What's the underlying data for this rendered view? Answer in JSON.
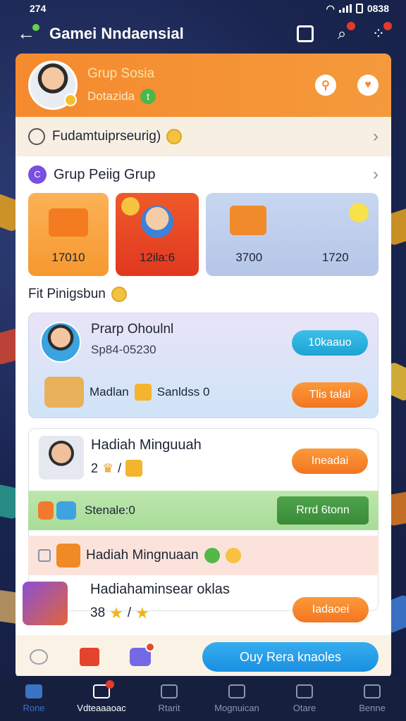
{
  "status": {
    "time": "274",
    "clock": "0838"
  },
  "appbar": {
    "title": "Gamei Nndaensial"
  },
  "profile": {
    "name": "Grup Sosia",
    "sub": "Dotazida",
    "sub_icon": "t"
  },
  "row1": {
    "label": "Fudamtuiprseurig)"
  },
  "group": {
    "label": "Grup Peiig Grup",
    "icon": "C"
  },
  "tiles": [
    {
      "value": "17010"
    },
    {
      "value": "12ila:6"
    },
    {
      "value_a": "3700",
      "value_b": "1720"
    }
  ],
  "section": {
    "title": "Fit Pinigsbun"
  },
  "box1": {
    "name": "Prarp Ohoulnl",
    "sub": "Sp84-05230",
    "btn_top": "10kaauo",
    "row_label_a": "Madlan",
    "row_label_b": "Sanldss 0",
    "btn_bottom": "Tlis talal"
  },
  "box2": {
    "title": "Hadiah Minguuah",
    "sub": "2",
    "btn": "Ineadai",
    "green_label": "Stenale:0",
    "green_btn": "Rrrd 6tonn",
    "pink_label": "Hadiah Mingnuaan",
    "b3_title": "Hadiahaminsear oklas",
    "b3_prefix": "38",
    "b3_btn": "Iadaoei"
  },
  "cta": {
    "label": "Ouy Rera knaoles"
  },
  "nav": [
    {
      "label": "Rone"
    },
    {
      "label": "Vdteaaaoac"
    },
    {
      "label": "Rtarit"
    },
    {
      "label": "Mognuican"
    },
    {
      "label": "Otare"
    },
    {
      "label": "Benne"
    }
  ]
}
